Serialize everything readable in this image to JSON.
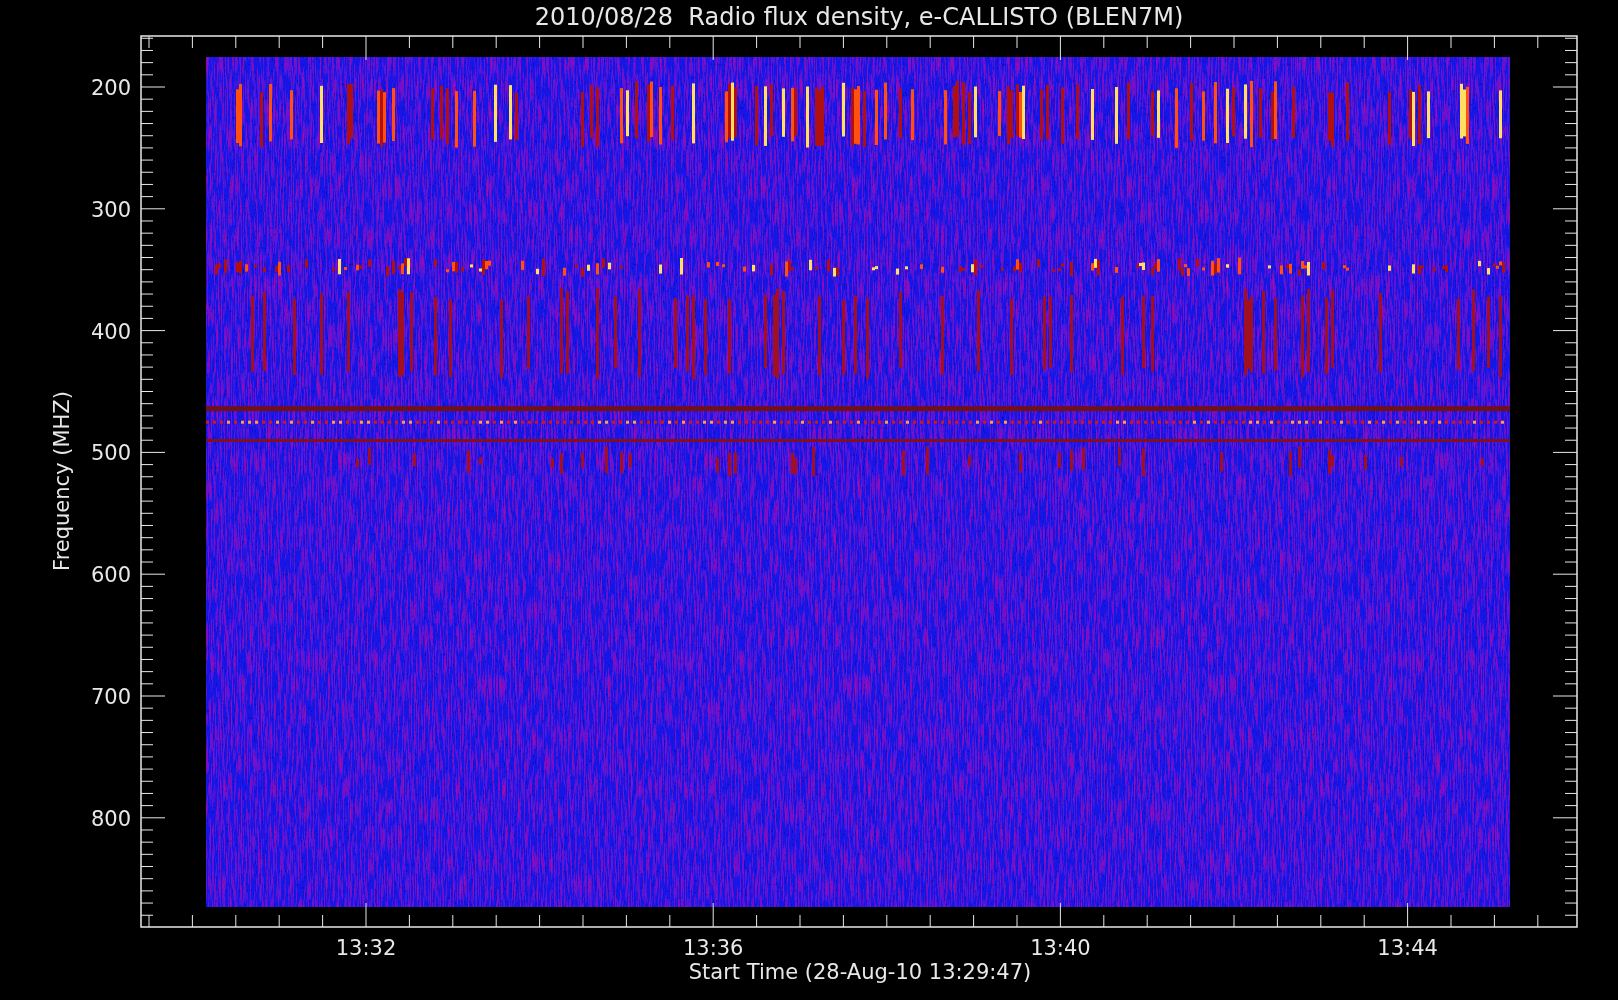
{
  "title": "2010/08/28  Radio flux density, e-CALLISTO (BLEN7M)",
  "y_axis": {
    "label": "Frequency (MHZ)",
    "ticks": [
      "200",
      "300",
      "400",
      "500",
      "600",
      "700",
      "800"
    ]
  },
  "x_axis": {
    "label": "Start Time (28-Aug-10 13:29:47)",
    "ticks": [
      "13:32",
      "13:36",
      "13:40",
      "13:44"
    ]
  }
}
